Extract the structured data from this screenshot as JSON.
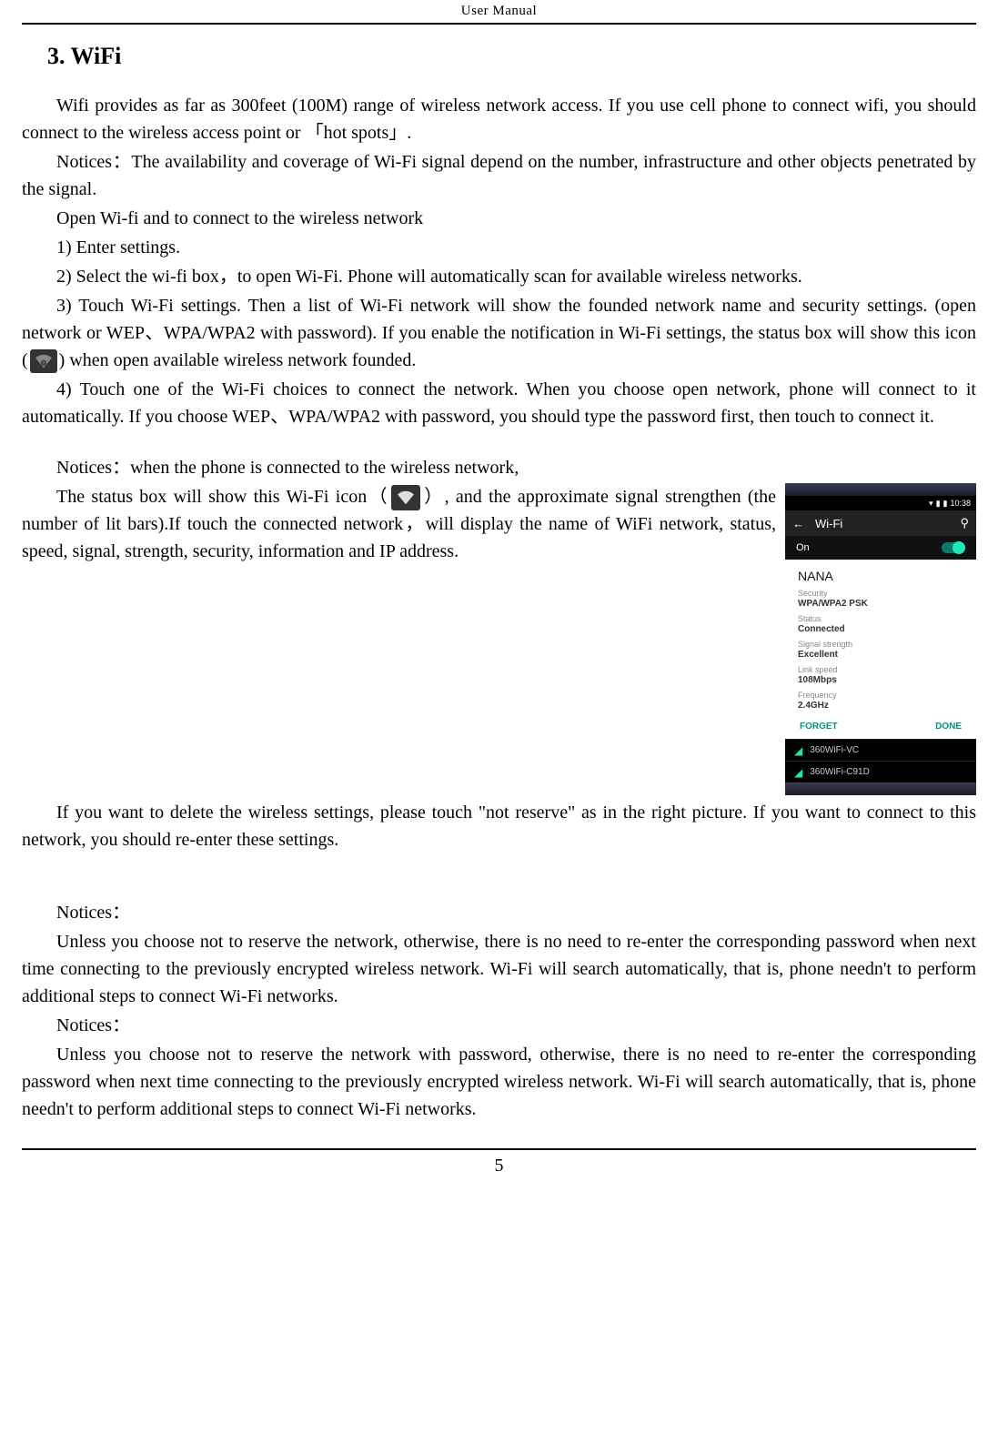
{
  "header": "User    Manual",
  "section_title": "3. WiFi",
  "p1": "Wifi provides as far as 300feet (100M) range of wireless network access. If you use cell phone to connect wifi, you should connect to the wireless access point or  「hot spots」.",
  "p2": "Notices：The availability and coverage of Wi-Fi signal depend on the number, infrastructure and other objects penetrated by the signal.",
  "p3": "Open Wi-fi and to connect to the wireless network",
  "p4": "1) Enter settings.",
  "p5": "2) Select the wi-fi box，to open Wi-Fi. Phone will automatically scan for available wireless networks.",
  "p6a": "3) Touch Wi-Fi settings. Then a list of Wi-Fi network will show the founded network name and security settings. (open network or WEP、WPA/WPA2 with password). If you enable the notification in Wi-Fi settings, the status box will show this icon (",
  "p6b": ") when open available wireless network founded.",
  "p7": "4) Touch one of the Wi-Fi choices to connect the network. When you choose open network, phone will connect to it automatically. If you choose WEP、WPA/WPA2 with password, you should type the password first, then touch to connect it.",
  "p8": "Notices：when the phone is connected to the wireless network,",
  "p9a": "The status box will show this Wi-Fi icon（",
  "p9b": "）, and the approximate signal strengthen (the number of lit bars).If touch the connected network，will display the name of WiFi   network, status, speed, signal, strength, security, information and IP address.",
  "p10": "If you want to delete the wireless settings, please touch \"not reserve\" as in the right picture. If you want to connect to this network, you should re-enter these settings.",
  "p11": "Notices：",
  "p12": "Unless you choose not to reserve the network, otherwise, there is no need to re-enter the corresponding password when next time connecting to the previously encrypted wireless network. Wi-Fi will search automatically, that is, phone needn't to perform additional steps to connect Wi-Fi networks.",
  "p13": "Notices：",
  "p14": "Unless you choose not to reserve the network with password, otherwise, there is no need to re-enter the corresponding password when next time connecting to the previously encrypted wireless network. Wi-Fi will search automatically, that is, phone needn't to perform additional steps to connect Wi-Fi networks.",
  "page_number": "5",
  "phone": {
    "time": "10:38",
    "title": "Wi-Fi",
    "on_label": "On",
    "dialog": {
      "title": "NANA",
      "security_label": "Security",
      "security_value": "WPA/WPA2 PSK",
      "status_label": "Status",
      "status_value": "Connected",
      "signal_label": "Signal strength",
      "signal_value": "Excellent",
      "speed_label": "Link speed",
      "speed_value": "108Mbps",
      "freq_label": "Frequency",
      "freq_value": "2.4GHz",
      "forget": "FORGET",
      "done": "DONE"
    },
    "net1": "360WiFi-VC",
    "net2": "360WiFi-C91D"
  }
}
